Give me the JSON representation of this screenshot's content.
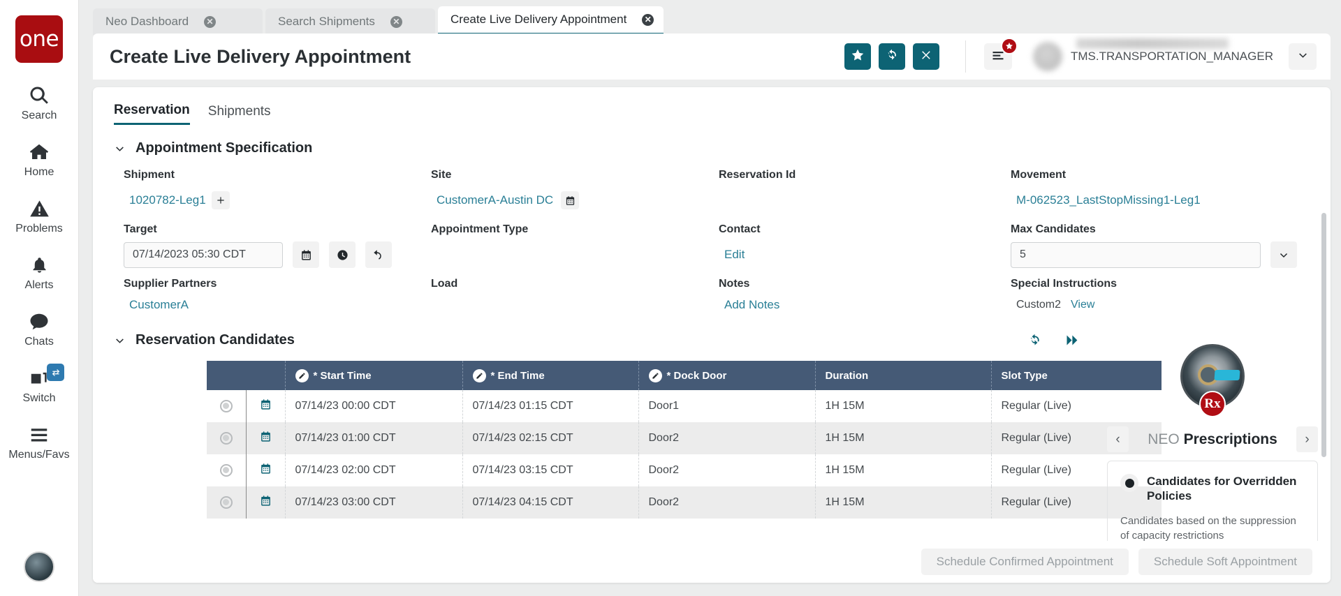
{
  "rail": {
    "logo_text": "one",
    "items": [
      {
        "label": "Search",
        "icon": "search-icon"
      },
      {
        "label": "Home",
        "icon": "home-icon"
      },
      {
        "label": "Problems",
        "icon": "warning-icon"
      },
      {
        "label": "Alerts",
        "icon": "bell-icon"
      },
      {
        "label": "Chats",
        "icon": "chat-icon"
      },
      {
        "label": "Switch",
        "icon": "switch-icon"
      },
      {
        "label": "Menus/Favs",
        "icon": "hamburger-icon"
      }
    ]
  },
  "tabs": [
    {
      "label": "Neo Dashboard",
      "active": false
    },
    {
      "label": "Search Shipments",
      "active": false
    },
    {
      "label": "Create Live Delivery Appointment",
      "active": true
    }
  ],
  "header": {
    "title": "Create Live Delivery Appointment",
    "actions": [
      {
        "name": "favorite-button",
        "icon": "star-icon"
      },
      {
        "name": "refresh-button",
        "icon": "refresh-icon"
      },
      {
        "name": "close-button",
        "icon": "close-icon"
      }
    ],
    "menu_icon": "hamburger-icon",
    "menu_badge_icon": "star-icon",
    "user_role": "TMS.TRANSPORTATION_MANAGER",
    "user_caret_icon": "chevron-down-icon",
    "accent_color": "#0d6374",
    "brand_color": "#a90d11"
  },
  "section_tabs": [
    {
      "label": "Reservation",
      "active": true
    },
    {
      "label": "Shipments",
      "active": false
    }
  ],
  "appointment_specification": {
    "title": "Appointment Specification",
    "fields": {
      "shipment_label": "Shipment",
      "shipment_value": "1020782-Leg1",
      "shipment_add_icon": "plus-icon",
      "site_label": "Site",
      "site_value": "CustomerA-Austin DC",
      "site_icon": "calendar-icon",
      "reservation_id_label": "Reservation Id",
      "reservation_id_value": "",
      "movement_label": "Movement",
      "movement_value": "M-062523_LastStopMissing1-Leg1",
      "target_label": "Target",
      "target_value": "07/14/2023 05:30 CDT",
      "target_icons": [
        "calendar-icon",
        "clock-icon",
        "undo-icon"
      ],
      "appointment_type_label": "Appointment Type",
      "appointment_type_value": "",
      "contact_label": "Contact",
      "contact_action": "Edit",
      "max_candidates_label": "Max Candidates",
      "max_candidates_value": "5",
      "max_candidates_caret": "chevron-down-icon",
      "supplier_partners_label": "Supplier Partners",
      "supplier_partners_value": "CustomerA",
      "load_label": "Load",
      "load_value": "",
      "notes_label": "Notes",
      "notes_action": "Add Notes",
      "special_instructions_label": "Special Instructions",
      "special_instructions_value": "Custom2",
      "special_instructions_action": "View"
    }
  },
  "reservation_candidates": {
    "title": "Reservation Candidates",
    "tools": [
      {
        "name": "refresh-candidates-icon",
        "icon": "refresh-icon"
      },
      {
        "name": "fast-forward-icon",
        "icon": "double-chevron-right-icon"
      }
    ],
    "columns": [
      {
        "label": "",
        "editable": false
      },
      {
        "label": "",
        "editable": false
      },
      {
        "label": "* Start Time",
        "editable": true
      },
      {
        "label": "* End Time",
        "editable": true
      },
      {
        "label": "* Dock Door",
        "editable": true
      },
      {
        "label": "Duration",
        "editable": false
      },
      {
        "label": "Slot Type",
        "editable": false
      }
    ],
    "rows": [
      {
        "start_time": "07/14/23 00:00 CDT",
        "end_time": "07/14/23 01:15 CDT",
        "dock_door": "Door1",
        "duration": "1H 15M",
        "slot_type": "Regular (Live)"
      },
      {
        "start_time": "07/14/23 01:00 CDT",
        "end_time": "07/14/23 02:15 CDT",
        "dock_door": "Door2",
        "duration": "1H 15M",
        "slot_type": "Regular (Live)"
      },
      {
        "start_time": "07/14/23 02:00 CDT",
        "end_time": "07/14/23 03:15 CDT",
        "dock_door": "Door2",
        "duration": "1H 15M",
        "slot_type": "Regular (Live)"
      },
      {
        "start_time": "07/14/23 03:00 CDT",
        "end_time": "07/14/23 04:15 CDT",
        "dock_door": "Door2",
        "duration": "1H 15M",
        "slot_type": "Regular (Live)"
      }
    ]
  },
  "neo_panel": {
    "avatar_badge": "Rx",
    "prev_arrow": "‹",
    "next_arrow": "›",
    "title_light": "NEO",
    "title_bold": "Prescriptions",
    "card_title": "Candidates for Overridden Policies",
    "card_body": "Candidates based on the suppression of capacity restrictions"
  },
  "footer": {
    "buttons": [
      {
        "label": "Schedule Confirmed Appointment",
        "name": "schedule-confirmed-appointment-button"
      },
      {
        "label": "Schedule Soft Appointment",
        "name": "schedule-soft-appointment-button"
      }
    ]
  }
}
